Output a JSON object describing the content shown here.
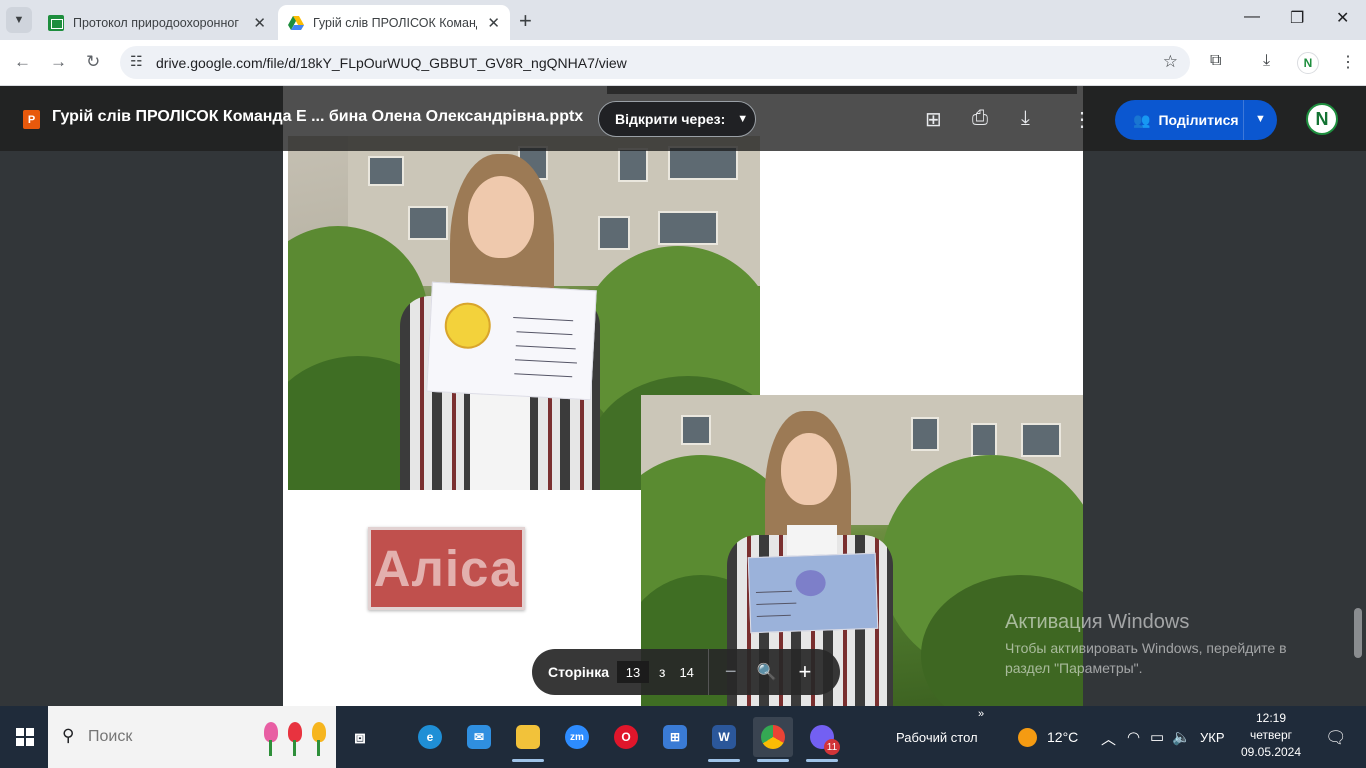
{
  "browser": {
    "tabs": [
      {
        "title": "Протокол природоохоронног",
        "active": false
      },
      {
        "title": "Гурій слів ПРОЛІСОК Команда",
        "active": true
      }
    ],
    "url": "drive.google.com/file/d/18kY_FLpOurWUQ_GBBUT_GV8R_ngQNHA7/view",
    "profile_initial": "N"
  },
  "viewer": {
    "file_name": "Гурій слів ПРОЛІСОК Команда Е ... бина Олена Олександрівна.pptx",
    "file_icon_letter": "P",
    "open_with_label": "Відкрити через:",
    "share_label": "Поділитися",
    "avatar_initial": "N"
  },
  "slide": {
    "name_label": "Аліса"
  },
  "pager": {
    "label": "Сторінка",
    "current_page": "13",
    "of_label": "з",
    "total_pages": "14"
  },
  "watermark": {
    "title": "Активация Windows",
    "message": "Чтобы активировать Windows, перейдите в раздел \"Параметры\"."
  },
  "taskbar": {
    "search_placeholder": "Поиск",
    "desktop_label": "Рабочий стол",
    "temperature": "12°C",
    "language": "УКР",
    "time": "12:19",
    "weekday": "четверг",
    "date": "09.05.2024",
    "viber_badge": "11",
    "apps": [
      "task-view",
      "edge",
      "mail",
      "file-explorer",
      "zoom",
      "opera",
      "store",
      "word",
      "chrome",
      "viber"
    ]
  },
  "colors": {
    "share_blue": "#0b57d0",
    "name_box_red": "#c0504d",
    "taskbar_bg": "#1f2b3a",
    "viewer_bg": "#323639"
  }
}
